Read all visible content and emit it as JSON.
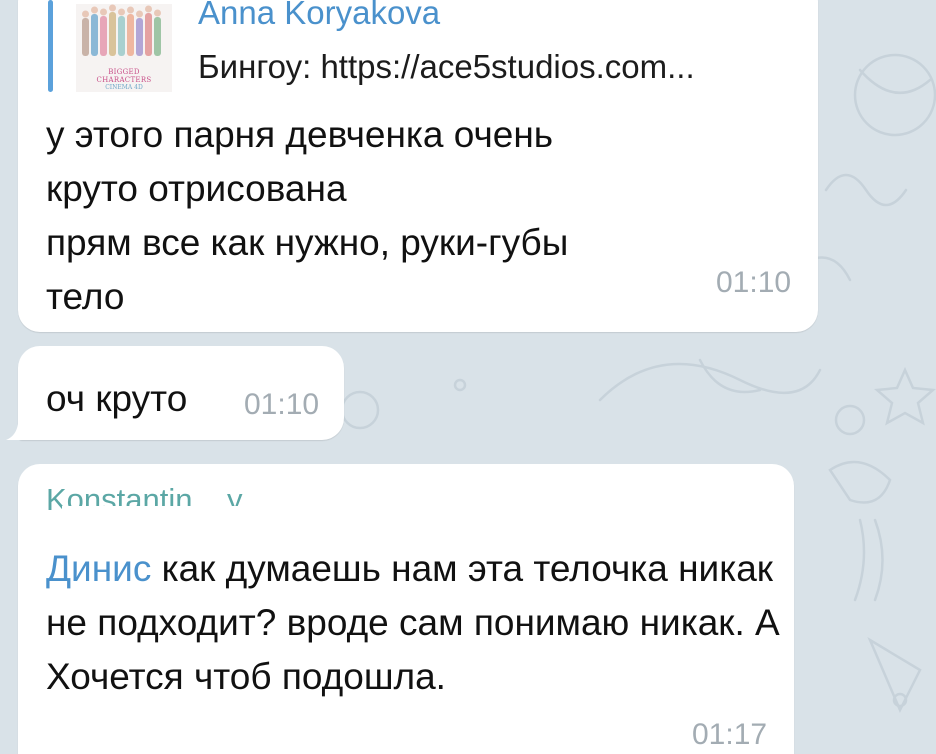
{
  "colors": {
    "background": "#d9e2e8",
    "bubble": "#ffffff",
    "accent_name": "#4a91cc",
    "reply_bar": "#5ba1db",
    "time": "#a3acb3",
    "sender_partial": "#5ba7a5"
  },
  "messages": [
    {
      "reply": {
        "author": "Anna Koryakova",
        "text": "Бингоу: https://ace5studios.com...",
        "thumbnail_caption": "BIGGED CHARACTERS",
        "thumbnail_subcaption": "CINEMA 4D"
      },
      "text": "у этого парня девченка очень\nкруто отрисована\nпрям все как нужно, руки-губы\nтело",
      "time": "01:10"
    },
    {
      "text": "оч круто",
      "time": "01:10"
    },
    {
      "sender": "Konstantin ...y",
      "mention": "Динис",
      "text": " как думаешь нам эта телочка никак не подходит? вроде сам понимаю никак. А Хочется чтоб подошла.",
      "time": "01:17"
    }
  ]
}
